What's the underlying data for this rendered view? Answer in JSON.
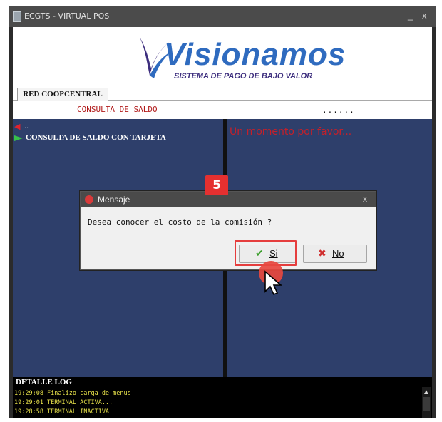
{
  "window": {
    "title": "ECGTS - VIRTUAL POS",
    "min_glyph": "_",
    "close_glyph": "x"
  },
  "banner": {
    "logo_word": "Visionamos",
    "logo_subtitle": "SISTEMA DE PAGO DE BAJO VALOR"
  },
  "tabs": [
    {
      "label": "RED COOPCENTRAL"
    }
  ],
  "header": {
    "title": "CONSULTA DE SALDO",
    "progress_dots": "......"
  },
  "left_panel": {
    "back_label": "..",
    "items": [
      {
        "label": "CONSULTA DE SALDO CON TARJETA"
      }
    ]
  },
  "right_panel": {
    "message": "Un momento por favor..."
  },
  "dialog": {
    "title": "Mensaje",
    "close_glyph": "x",
    "message": "Desea conocer el costo de la comisión ?",
    "yes_label": "Si",
    "no_label": "No",
    "yes_glyph": "✔",
    "no_glyph": "✖"
  },
  "annotation": {
    "step_number": "5"
  },
  "log": {
    "header": "DETALLE LOG",
    "lines": [
      "19:29:08 Finalizo carga de menus",
      "19:29:01 TERMINAL ACTIVA...",
      "19:28:58 TERMINAL INACTIVA"
    ]
  },
  "colors": {
    "panel_bg": "#2e3f6b",
    "alert_red": "#c4202a",
    "annotation_red": "#e53030",
    "log_text": "#e6e04a"
  }
}
